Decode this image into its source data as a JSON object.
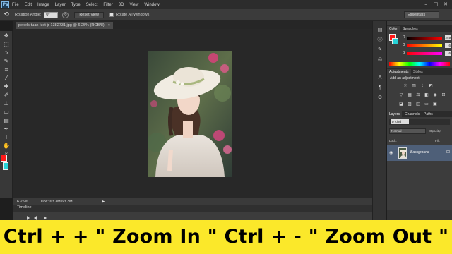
{
  "menu": {
    "logo": "Ps",
    "items": [
      "File",
      "Edit",
      "Image",
      "Layer",
      "Type",
      "Select",
      "Filter",
      "3D",
      "View",
      "Window"
    ],
    "window_controls": [
      "–",
      "□",
      "✕"
    ]
  },
  "options_bar": {
    "tool_icon": "rotate-view-icon",
    "rotation_label": "Rotation Angle:",
    "rotation_value": "0°",
    "reset_view_label": "Reset View",
    "rotate_all_label": "Rotate All Windows",
    "rotate_all_checked": false,
    "workspace": "Essentials"
  },
  "document": {
    "tab_title": "pexels-tuan-kiet-jr-1382731.jpg @ 6.25% (RGB/8)",
    "close_glyph": "×",
    "zoom": "6.25%",
    "doc_size": "Doc: 63.3M/63.3M"
  },
  "timeline": {
    "label": "Timeline"
  },
  "color_panel": {
    "tabs": [
      "Color",
      "Swatches"
    ],
    "foreground": "#ff1a1a",
    "background": "#27d3d8",
    "sliders": [
      {
        "label": "R",
        "value": "249"
      },
      {
        "label": "G",
        "value": "6"
      },
      {
        "label": "B",
        "value": "6"
      }
    ]
  },
  "adjustments_panel": {
    "tabs": [
      "Adjustments",
      "Styles"
    ],
    "title": "Add an adjustment"
  },
  "layers_panel": {
    "tabs": [
      "Layers",
      "Channels",
      "Paths"
    ],
    "filter_kind": "ρ Kind",
    "blend_mode": "Normal",
    "opacity_label": "Opacity:",
    "lock_label": "Lock:",
    "fill_label": "Fill:",
    "layer_name": "Background"
  },
  "caption": {
    "text": "Ctrl + + \" Zoom In \" Ctrl + - \"  Zoom Out \""
  }
}
